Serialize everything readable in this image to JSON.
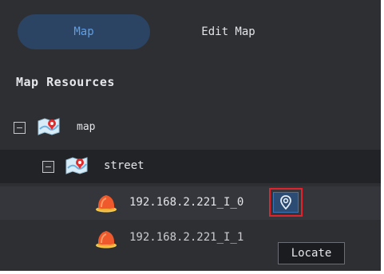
{
  "tabs": [
    {
      "label": "Map",
      "active": true
    },
    {
      "label": "Edit Map",
      "active": false
    }
  ],
  "section_title": "Map Resources",
  "tree": {
    "root": {
      "label": "map",
      "icon": "map-icon",
      "expanded": true
    },
    "child": {
      "label": "street",
      "icon": "map-icon",
      "expanded": true
    },
    "devices": [
      {
        "label": "192.168.2.221_I_0",
        "icon": "alarm-input-icon",
        "selected": true
      },
      {
        "label": "192.168.2.221_I_1",
        "icon": "alarm-input-icon",
        "selected": false
      }
    ]
  },
  "locate_button": {
    "icon": "locate-pin-icon"
  },
  "tooltip": "Locate",
  "colors": {
    "background": "#2e2f33",
    "active_tab_bg": "#2b4464",
    "active_tab_text": "#5d9fe8",
    "highlight_border": "#e1242b",
    "locate_bg": "#2d4c73"
  }
}
